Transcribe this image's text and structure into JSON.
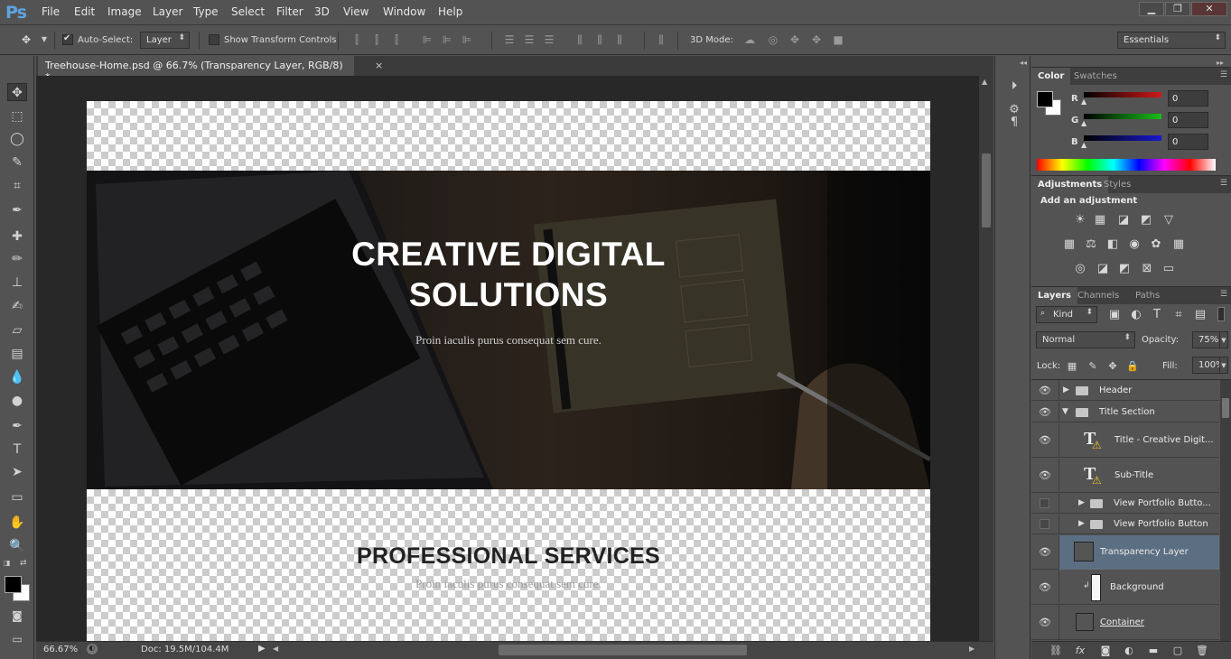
{
  "app": {
    "logo": "Ps"
  },
  "menu": [
    "File",
    "Edit",
    "Image",
    "Layer",
    "Type",
    "Select",
    "Filter",
    "3D",
    "View",
    "Window",
    "Help"
  ],
  "window_controls": {
    "minimize": "▁",
    "restore": "❐",
    "close": "✕"
  },
  "options": {
    "auto_select_label": "Auto-Select:",
    "auto_select_checked": true,
    "auto_select_target": "Layer",
    "show_transform_label": "Show Transform Controls",
    "show_transform_checked": false,
    "mode_3d_label": "3D Mode:",
    "workspace": "Essentials"
  },
  "document": {
    "tab_title": "Treehouse-Home.psd @ 66.7% (Transparency Layer, RGB/8) *",
    "tab_close": "×",
    "hero_title_line1": "CREATIVE DIGITAL",
    "hero_title_line2": "SOLUTIONS",
    "hero_subtitle": "Proin iaculis purus consequat sem cure.",
    "services_title": "PROFESSIONAL SERVICES",
    "services_subtitle": "Proin iaculis purus consequat sem cure."
  },
  "status": {
    "zoom": "66.67%",
    "doc_size": "Doc: 19.5M/104.4M"
  },
  "color_panel": {
    "tabs": [
      "Color",
      "Swatches"
    ],
    "channels": [
      {
        "label": "R",
        "value": "0",
        "color": "#d01818"
      },
      {
        "label": "G",
        "value": "0",
        "color": "#18c018"
      },
      {
        "label": "B",
        "value": "0",
        "color": "#1818d0"
      }
    ],
    "foreground": "#000000",
    "background": "#ffffff"
  },
  "adjustments_panel": {
    "tabs": [
      "Adjustments",
      "Styles"
    ],
    "heading": "Add an adjustment"
  },
  "layers_panel": {
    "tabs": [
      "Layers",
      "Channels",
      "Paths"
    ],
    "filter_kind": "Kind",
    "blend_mode": "Normal",
    "opacity_label": "Opacity:",
    "opacity": "75%",
    "lock_label": "Lock:",
    "fill_label": "Fill:",
    "fill": "100%",
    "layers": [
      {
        "name": "Header",
        "type": "group",
        "visible": true,
        "expanded": false
      },
      {
        "name": "Title Section",
        "type": "group",
        "visible": true,
        "expanded": true
      },
      {
        "name": "Title - Creative Digit...",
        "type": "text",
        "visible": true,
        "warning": true
      },
      {
        "name": "Sub-Title",
        "type": "text",
        "visible": true,
        "warning": true
      },
      {
        "name": "View Portfolio Butto...",
        "type": "group",
        "visible": false,
        "expanded": false
      },
      {
        "name": "View Portfolio Button",
        "type": "group",
        "visible": false,
        "expanded": false
      },
      {
        "name": "Transparency Layer",
        "type": "smart",
        "visible": true,
        "selected": true
      },
      {
        "name": "Background",
        "type": "pixel",
        "visible": true
      },
      {
        "name": "Container",
        "type": "smart",
        "visible": true
      }
    ]
  }
}
